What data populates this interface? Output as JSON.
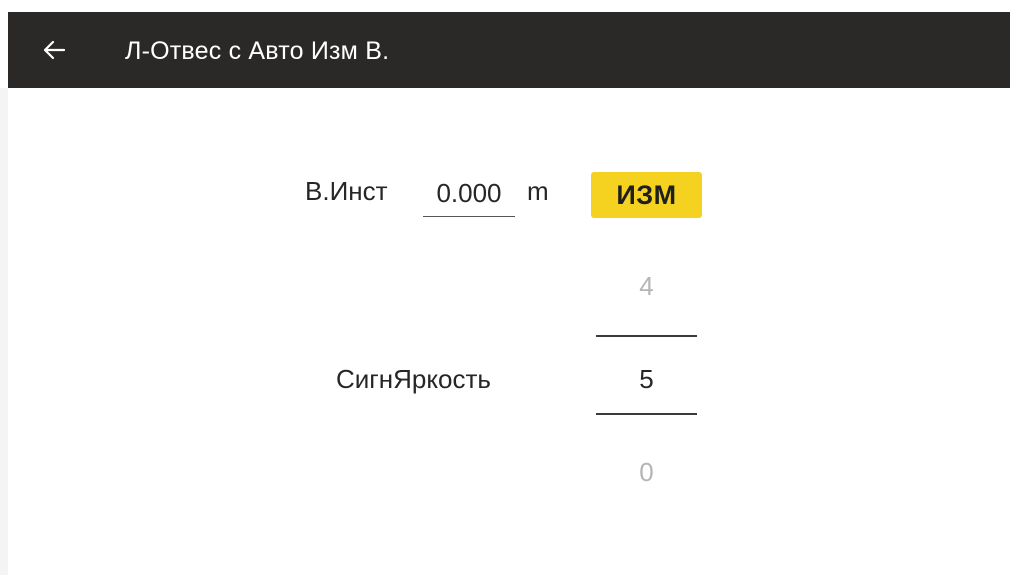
{
  "header": {
    "back_icon": "arrow-left-icon",
    "title": "Л-Отвес с Авто Изм В."
  },
  "instrument_height": {
    "label": "В.Инст",
    "value": "0.000",
    "unit": "m",
    "measure_button": "ИЗМ"
  },
  "brightness": {
    "label": "СигнЯркость",
    "prev_value": "4",
    "current_value": "5",
    "next_value": "0"
  },
  "colors": {
    "toolbar_bg": "#2b2927",
    "accent": "#f5d21f"
  }
}
